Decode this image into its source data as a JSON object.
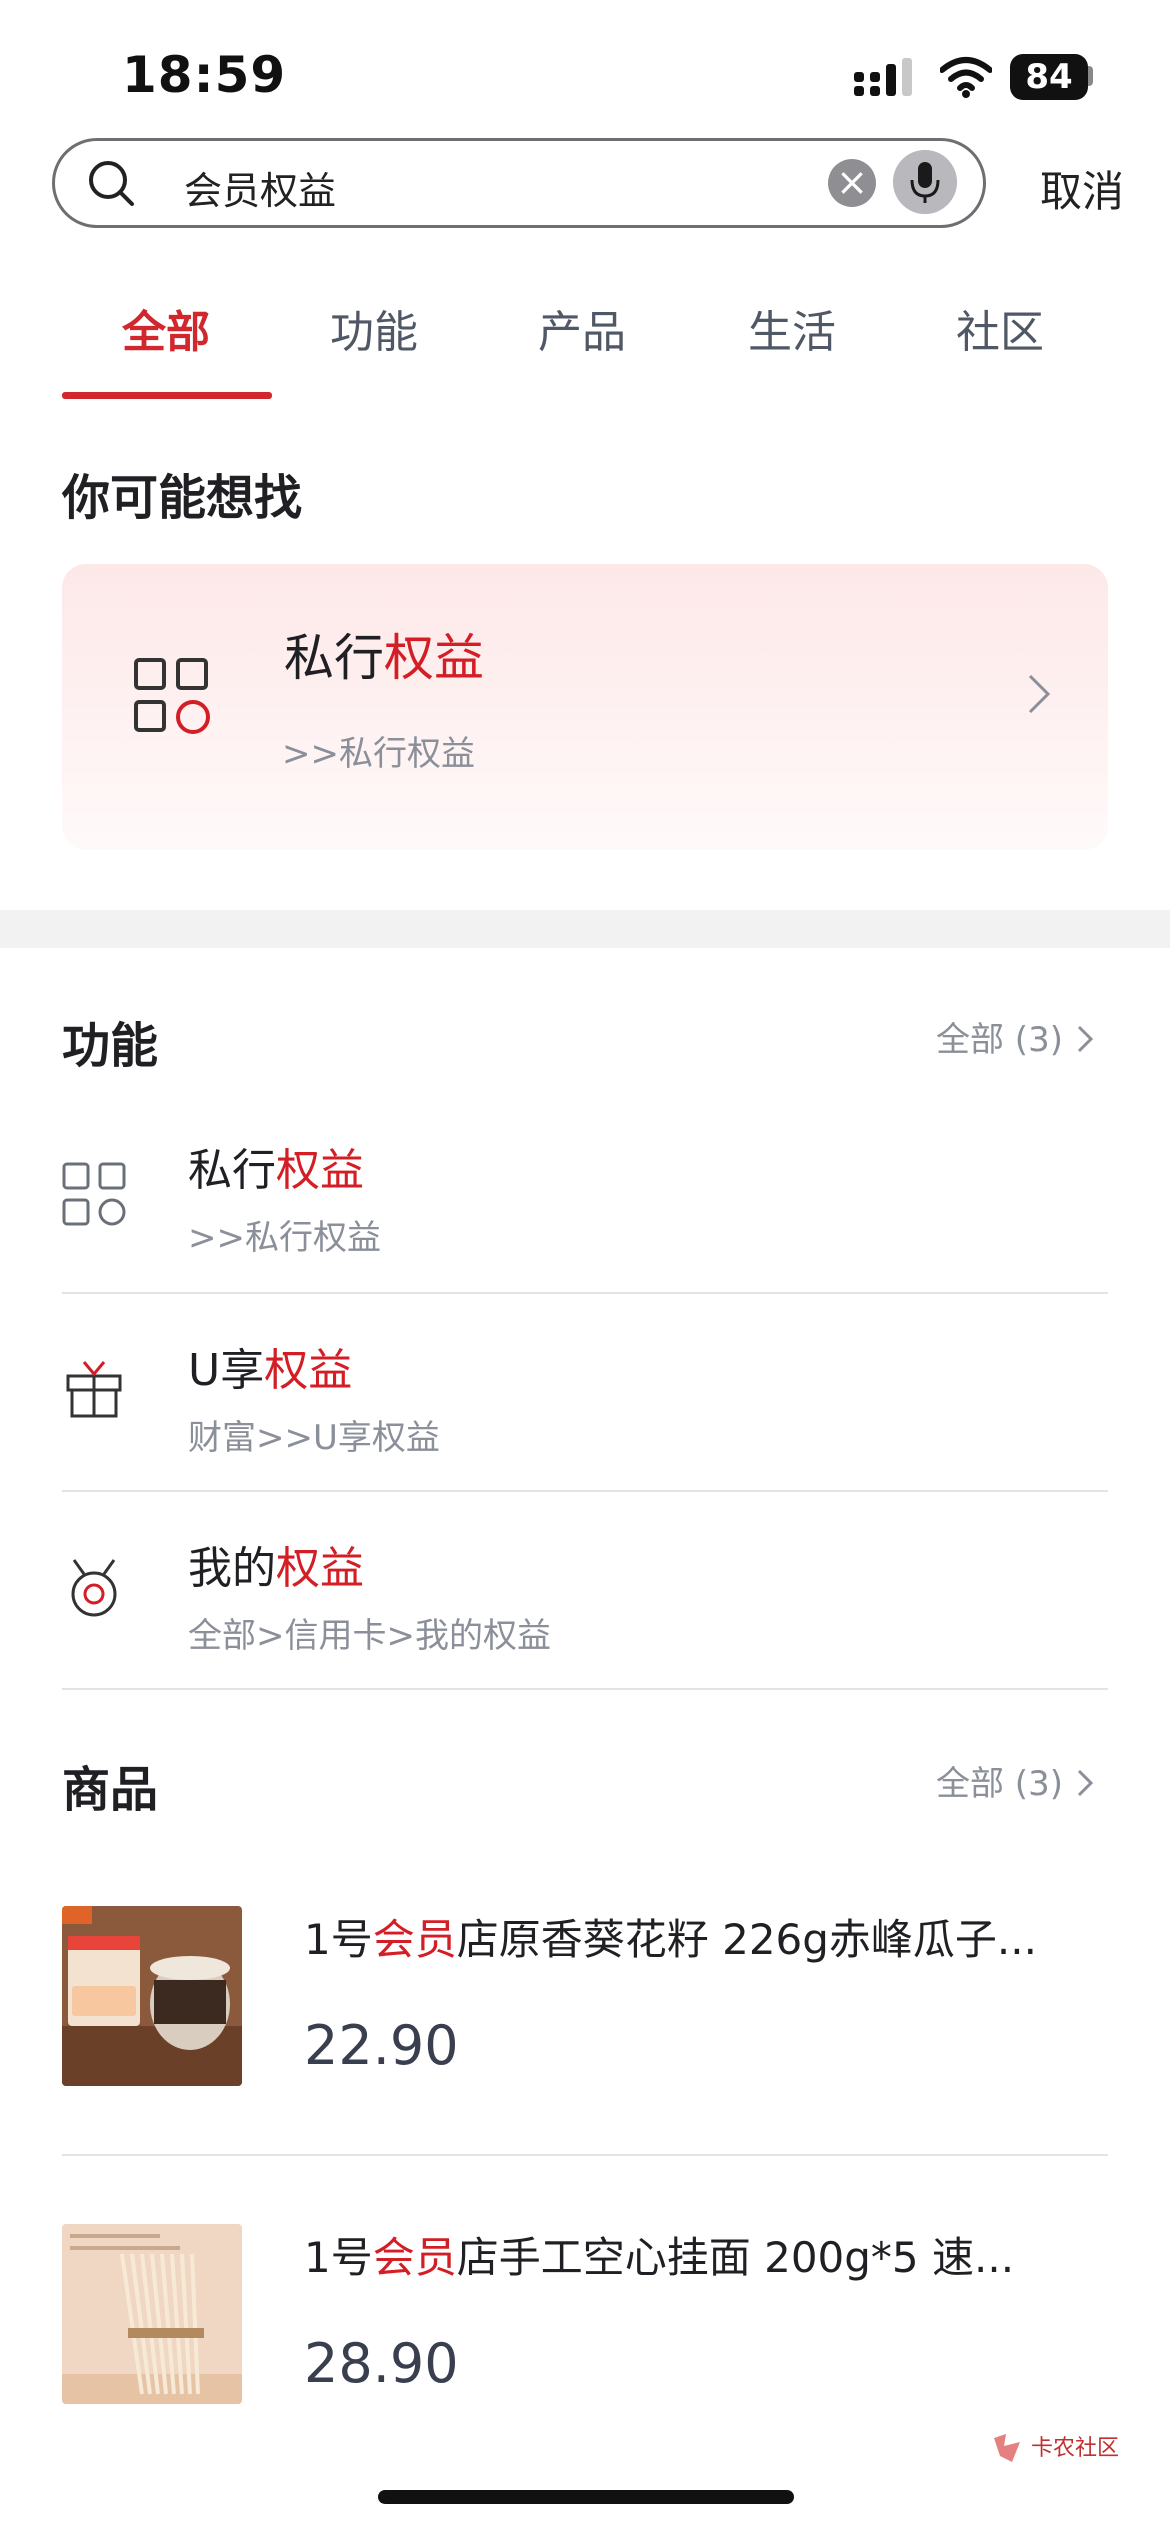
{
  "status_bar": {
    "time": "18:59",
    "battery": "84"
  },
  "search": {
    "query": "会员权益",
    "cancel_label": "取消"
  },
  "tabs": [
    {
      "label": "全部",
      "active": true
    },
    {
      "label": "功能",
      "active": false
    },
    {
      "label": "产品",
      "active": false
    },
    {
      "label": "生活",
      "active": false
    },
    {
      "label": "社区",
      "active": false
    }
  ],
  "suggestion": {
    "section_title": "你可能想找",
    "title_plain": "私行",
    "title_highlight": "权益",
    "path": ">>私行权益"
  },
  "features": {
    "section_title": "功能",
    "more_label": "全部 (3)",
    "items": [
      {
        "title_plain": "私行",
        "title_highlight": "权益",
        "path": ">>私行权益",
        "icon": "grid-icon"
      },
      {
        "title_plain": "U享",
        "title_highlight": "权益",
        "path": "财富>>U享权益",
        "icon": "gift-icon"
      },
      {
        "title_plain": "我的",
        "title_highlight": "权益",
        "path": "全部>信用卡>我的权益",
        "icon": "medal-icon"
      }
    ]
  },
  "products": {
    "section_title": "商品",
    "more_label": "全部 (3)",
    "items": [
      {
        "title_prefix": "1号",
        "title_highlight": "会员",
        "title_rest": "店原香葵花籽 226g赤峰瓜子...",
        "price": "22.90"
      },
      {
        "title_prefix": "1号",
        "title_highlight": "会员",
        "title_rest": "店手工空心挂面 200g*5 速...",
        "price": "28.90"
      }
    ]
  },
  "watermark": "卡农社区",
  "colors": {
    "accent": "#d0282d",
    "highlight": "#d31e25"
  }
}
